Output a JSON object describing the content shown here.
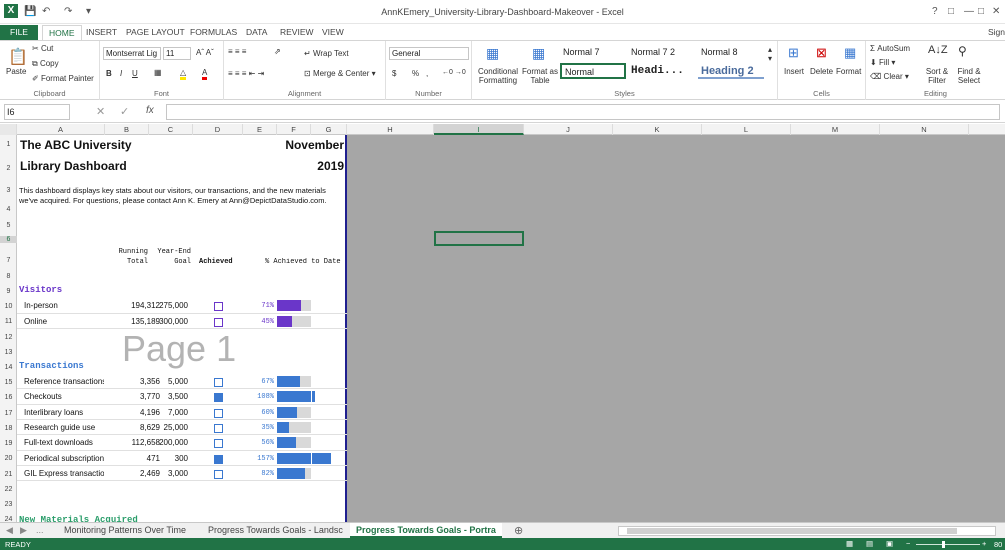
{
  "window": {
    "title": "AnnKEmery_University-Library-Dashboard-Makeover - Excel",
    "signin": "Sign",
    "help": "?"
  },
  "ribbon_tabs": [
    "FILE",
    "HOME",
    "INSERT",
    "PAGE LAYOUT",
    "FORMULAS",
    "DATA",
    "REVIEW",
    "VIEW"
  ],
  "ribbon": {
    "clipboard": {
      "label": "Clipboard",
      "paste": "Paste",
      "cut": "Cut",
      "copy": "Copy",
      "format_painter": "Format Painter"
    },
    "font": {
      "label": "Font",
      "family": "Montserrat Lig",
      "size": "11",
      "bold": "B",
      "italic": "I",
      "underline": "U"
    },
    "alignment": {
      "label": "Alignment",
      "wrap": "Wrap Text",
      "merge": "Merge & Center"
    },
    "number": {
      "label": "Number",
      "format": "General",
      "currency": "$",
      "percent": "%",
      "comma": ","
    },
    "styles": {
      "label": "Styles",
      "conditional": "Conditional Formatting",
      "format_table": "Format as Table",
      "cells": [
        "Normal 7",
        "Normal 7 2",
        "Normal 8",
        "Normal",
        "Headi...",
        "Heading 2"
      ]
    },
    "cells": {
      "label": "Cells",
      "insert": "Insert",
      "delete": "Delete",
      "format": "Format"
    },
    "editing": {
      "label": "Editing",
      "autosum": "AutoSum",
      "fill": "Fill",
      "clear": "Clear",
      "sort": "Sort & Filter",
      "find": "Find & Select"
    }
  },
  "formula_bar": {
    "name_box": "I6",
    "fx": "fx",
    "value": ""
  },
  "columns": [
    "A",
    "B",
    "C",
    "D",
    "E",
    "F",
    "G",
    "H",
    "I",
    "J",
    "K",
    "L",
    "M",
    "N"
  ],
  "rows": [
    "1",
    "2",
    "3",
    "4",
    "5",
    "6",
    "7",
    "8",
    "9",
    "10",
    "11",
    "12",
    "13",
    "14",
    "15",
    "16",
    "17",
    "18",
    "19",
    "20",
    "21",
    "22",
    "23",
    "24"
  ],
  "sheet": {
    "title_line1": "The ABC University",
    "title_line2": "Library Dashboard",
    "month": "November",
    "year": "2019",
    "description_line1": "This dashboard displays key stats about our visitors, our transactions, and the new materials",
    "description_line2": "we've acquired. For questions, please contact Ann K. Emery at Ann@DepictDataStudio.com.",
    "headers": {
      "running": "Running",
      "total": "Total",
      "year_end": "Year-End",
      "goal": "Goal",
      "achieved": "Achieved",
      "pct": "% Achieved to Date"
    },
    "page_watermark": "Page 1",
    "sections": {
      "visitors": {
        "label": "Visitors",
        "color": "#6a36c9",
        "rows": [
          {
            "name": "In-person",
            "total": "194,312",
            "goal": "275,000",
            "achieved": false,
            "pct": "71%",
            "value": 0.71
          },
          {
            "name": "Online",
            "total": "135,189",
            "goal": "300,000",
            "achieved": false,
            "pct": "45%",
            "value": 0.45
          }
        ]
      },
      "transactions": {
        "label": "Transactions",
        "color": "#3a78d0",
        "rows": [
          {
            "name": "Reference transactions",
            "total": "3,356",
            "goal": "5,000",
            "achieved": false,
            "pct": "67%",
            "value": 0.67
          },
          {
            "name": "Checkouts",
            "total": "3,770",
            "goal": "3,500",
            "achieved": true,
            "pct": "108%",
            "value": 1.08
          },
          {
            "name": "Interlibrary loans",
            "total": "4,196",
            "goal": "7,000",
            "achieved": false,
            "pct": "60%",
            "value": 0.6
          },
          {
            "name": "Research guide use",
            "total": "8,629",
            "goal": "25,000",
            "achieved": false,
            "pct": "35%",
            "value": 0.35
          },
          {
            "name": "Full-text downloads",
            "total": "112,658",
            "goal": "200,000",
            "achieved": false,
            "pct": "56%",
            "value": 0.56
          },
          {
            "name": "Periodical subscriptions",
            "total": "471",
            "goal": "300",
            "achieved": true,
            "pct": "157%",
            "value": 1.57
          },
          {
            "name": "GIL Express transactior",
            "total": "2,469",
            "goal": "3,000",
            "achieved": false,
            "pct": "82%",
            "value": 0.82
          }
        ]
      },
      "new_materials": {
        "label": "New Materials Acquired"
      }
    }
  },
  "sheet_tabs": [
    "Monitoring Patterns Over Time",
    "Progress Towards Goals - Landsc",
    "Progress Towards Goals - Portra"
  ],
  "status": {
    "ready": "READY",
    "zoom": "80"
  }
}
